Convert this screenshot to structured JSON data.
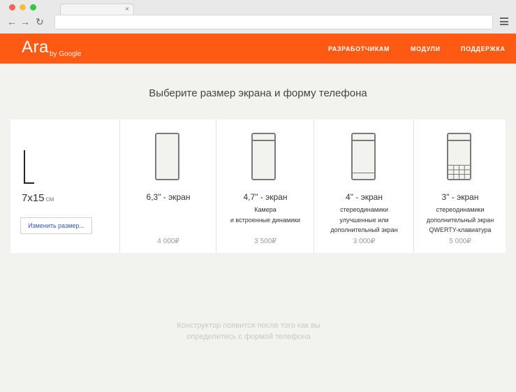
{
  "browser": {
    "tab_close": "×",
    "nav": {
      "back": "←",
      "forward": "→",
      "reload": "↻"
    }
  },
  "header": {
    "logo": "Ara",
    "logo_sub": "by Google",
    "nav": [
      "РАЗРАБОТЧИКАМ",
      "МОДУЛИ",
      "ПОДДЕРЖКА"
    ]
  },
  "page": {
    "title": "Выберите размер экрана и форму телефона"
  },
  "size": {
    "value": "7x15",
    "unit": "см",
    "change_button": "Изменить размер..."
  },
  "options": [
    {
      "title": "6,3\" - экран",
      "desc": [],
      "price": "4 000₽",
      "icon": "phone-fullscreen-icon"
    },
    {
      "title": "4,7\" - экран",
      "desc": [
        "Камера",
        "и встроенные динамики"
      ],
      "price": "3 500₽",
      "icon": "phone-camera-icon"
    },
    {
      "title": "4\" - экран",
      "desc": [
        "стереодинамики",
        "улучшенные или",
        "дополнительный экран"
      ],
      "price": "3 000₽",
      "icon": "phone-stereo-icon"
    },
    {
      "title": "3\" - экран",
      "desc": [
        "стереодинамики",
        "дополнительный экран",
        "QWERTY-клавиатура"
      ],
      "price": "5 000₽",
      "icon": "phone-keyboard-icon"
    }
  ],
  "footer": {
    "message": "Конструктор появится после того как вы определитесь с формой телефона"
  },
  "colors": {
    "accent": "#ff5a14",
    "background": "#f2f2ee",
    "link": "#2a57b0"
  }
}
